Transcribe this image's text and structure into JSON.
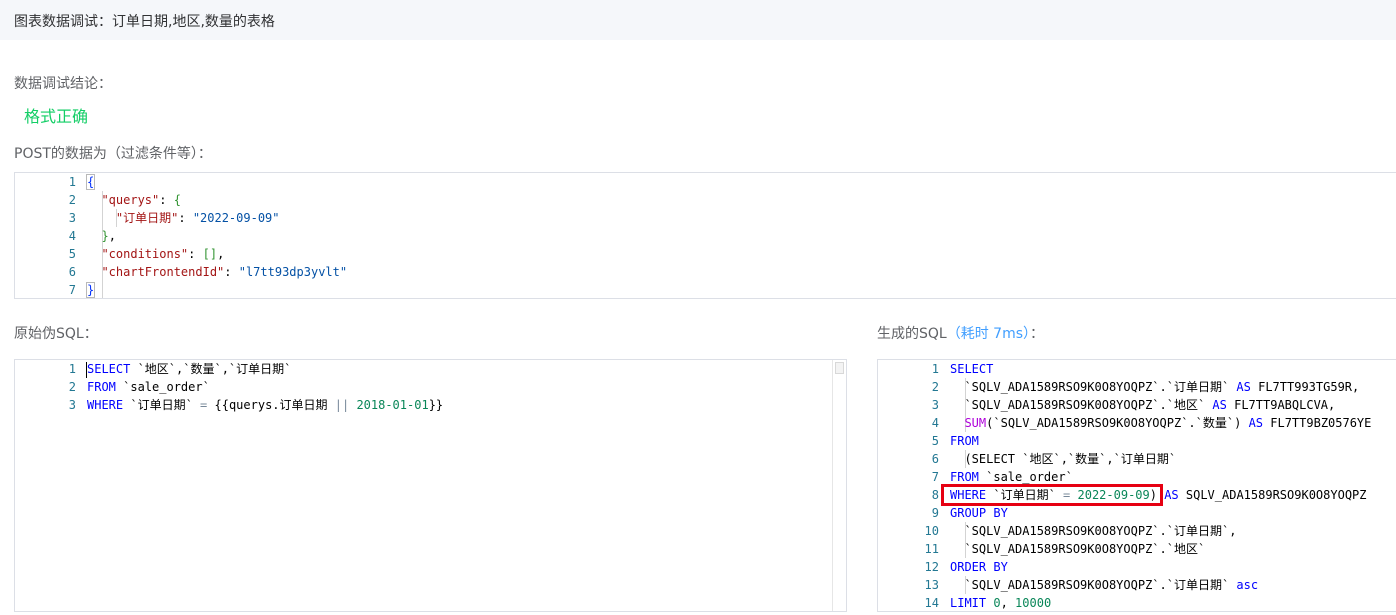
{
  "header": {
    "title": "图表数据调试：订单日期,地区,数量的表格"
  },
  "conclusion": {
    "label": "数据调试结论：",
    "status": "格式正确",
    "status_color": "#13ce66"
  },
  "post_data": {
    "label": "POST的数据为（过滤条件等）：",
    "lines": [
      {
        "n": "1",
        "tokens": [
          {
            "t": "{",
            "c": "brace bracket-box"
          }
        ]
      },
      {
        "n": "2",
        "tokens": [
          {
            "t": "  "
          },
          {
            "t": "\"querys\"",
            "c": "jkey"
          },
          {
            "t": ": "
          },
          {
            "t": "{",
            "c": "brk"
          }
        ]
      },
      {
        "n": "3",
        "tokens": [
          {
            "t": "    "
          },
          {
            "t": "\"订单日期\"",
            "c": "jkey"
          },
          {
            "t": ": "
          },
          {
            "t": "\"2022-09-09\"",
            "c": "jstr"
          }
        ]
      },
      {
        "n": "4",
        "tokens": [
          {
            "t": "  "
          },
          {
            "t": "}",
            "c": "brk"
          },
          {
            "t": ","
          }
        ]
      },
      {
        "n": "5",
        "tokens": [
          {
            "t": "  "
          },
          {
            "t": "\"conditions\"",
            "c": "jkey"
          },
          {
            "t": ": "
          },
          {
            "t": "[]",
            "c": "brk"
          },
          {
            "t": ","
          }
        ]
      },
      {
        "n": "6",
        "tokens": [
          {
            "t": "  "
          },
          {
            "t": "\"chartFrontendId\"",
            "c": "jkey"
          },
          {
            "t": ": "
          },
          {
            "t": "\"l7tt93dp3yvlt\"",
            "c": "jstr"
          }
        ]
      },
      {
        "n": "7",
        "tokens": [
          {
            "t": "}",
            "c": "brace bracket-box"
          }
        ]
      }
    ]
  },
  "raw_sql": {
    "label": "原始伪SQL：",
    "lines": [
      {
        "n": "1",
        "tokens": [
          {
            "t": "SELECT",
            "c": "kw"
          },
          {
            "t": " `地区`,`数量`,`订单日期`"
          }
        ]
      },
      {
        "n": "2",
        "tokens": [
          {
            "t": "FROM",
            "c": "kw"
          },
          {
            "t": " `sale_order`"
          }
        ]
      },
      {
        "n": "3",
        "tokens": [
          {
            "t": "WHERE",
            "c": "kw"
          },
          {
            "t": " `订单日期` "
          },
          {
            "t": "=",
            "c": "op"
          },
          {
            "t": " {{querys.订单日期 "
          },
          {
            "t": "||",
            "c": "op"
          },
          {
            "t": " "
          },
          {
            "t": "2018-01-01",
            "c": "num"
          },
          {
            "t": "}}"
          }
        ]
      }
    ]
  },
  "generated_sql": {
    "label_prefix": "生成的SQL",
    "elapsed": "（耗时 7ms）",
    "label_suffix": "：",
    "accent_color": "#409eff",
    "lines": [
      {
        "n": "1",
        "tokens": [
          {
            "t": "SELECT",
            "c": "kw"
          }
        ]
      },
      {
        "n": "2",
        "tokens": [
          {
            "t": "  `SQLV_ADA1589RSO9K0O8YOQPZ`.`订单日期` "
          },
          {
            "t": "AS",
            "c": "kw"
          },
          {
            "t": " FL7TT993TG59R,"
          }
        ]
      },
      {
        "n": "3",
        "tokens": [
          {
            "t": "  `SQLV_ADA1589RSO9K0O8YOQPZ`.`地区` "
          },
          {
            "t": "AS",
            "c": "kw"
          },
          {
            "t": " FL7TT9ABQLCVA,"
          }
        ]
      },
      {
        "n": "4",
        "tokens": [
          {
            "t": "  "
          },
          {
            "t": "SUM",
            "c": "fn"
          },
          {
            "t": "(`SQLV_ADA1589RSO9K0O8YOQPZ`.`数量`) "
          },
          {
            "t": "AS",
            "c": "kw"
          },
          {
            "t": " FL7TT9BZ0576YE"
          }
        ]
      },
      {
        "n": "5",
        "tokens": [
          {
            "t": "FROM",
            "c": "kw"
          }
        ]
      },
      {
        "n": "6",
        "tokens": [
          {
            "t": "  (SELECT `地区`,`数量`,`订单日期`"
          }
        ]
      },
      {
        "n": "7",
        "tokens": [
          {
            "t": "FROM",
            "c": "kw"
          },
          {
            "t": " `sale_order`"
          }
        ]
      },
      {
        "n": "8",
        "tokens": [
          {
            "t": "WHERE",
            "c": "kw"
          },
          {
            "t": " `订单日期` "
          },
          {
            "t": "=",
            "c": "op"
          },
          {
            "t": " "
          },
          {
            "t": "2022-09-09",
            "c": "num"
          },
          {
            "t": ") "
          },
          {
            "t": "AS",
            "c": "kw"
          },
          {
            "t": " SQLV_ADA1589RSO9K0O8YOQPZ"
          }
        ]
      },
      {
        "n": "9",
        "tokens": [
          {
            "t": "GROUP BY",
            "c": "kw"
          }
        ]
      },
      {
        "n": "10",
        "tokens": [
          {
            "t": "  `SQLV_ADA1589RSO9K0O8YOQPZ`.`订单日期`,"
          }
        ]
      },
      {
        "n": "11",
        "tokens": [
          {
            "t": "  `SQLV_ADA1589RSO9K0O8YOQPZ`.`地区`"
          }
        ]
      },
      {
        "n": "12",
        "tokens": [
          {
            "t": "ORDER BY",
            "c": "kw"
          }
        ]
      },
      {
        "n": "13",
        "tokens": [
          {
            "t": "  `SQLV_ADA1589RSO9K0O8YOQPZ`.`订单日期` "
          },
          {
            "t": "asc",
            "c": "kw"
          }
        ]
      },
      {
        "n": "14",
        "tokens": [
          {
            "t": "LIMIT",
            "c": "kw"
          },
          {
            "t": " "
          },
          {
            "t": "0",
            "c": "num"
          },
          {
            "t": ", "
          },
          {
            "t": "10000",
            "c": "num"
          }
        ]
      }
    ]
  },
  "colors": {
    "highlight": "#e60012",
    "header_bg": "#f5f7fa",
    "line_number": "#237893"
  }
}
